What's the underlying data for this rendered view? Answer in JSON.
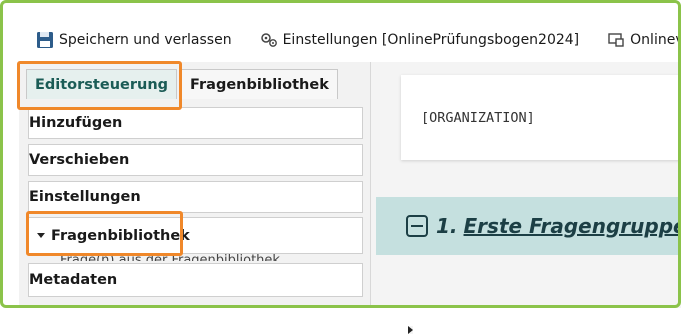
{
  "toolbar": {
    "save_label": "Speichern und verlassen",
    "settings_label": "Einstellungen [OnlinePrüfungsbogen2024]",
    "online_label": "Onlinevo"
  },
  "tabs": [
    "Editorsteuerung",
    "Fragenbibliothek"
  ],
  "accordion": [
    {
      "label": "Hinzufügen",
      "expanded": false
    },
    {
      "label": "Verschieben",
      "expanded": false
    },
    {
      "label": "Einstellungen",
      "expanded": false
    },
    {
      "label": "Fragenbibliothek",
      "expanded": true
    },
    {
      "label": "Metadaten",
      "expanded": false
    }
  ],
  "accordion_clipped_text": "Frage(n) aus der Fragenbibliothek",
  "card_text": "[ORGANIZATION]",
  "group": {
    "number": "1.",
    "title": "Erste Fragengruppe"
  },
  "colors": {
    "frame": "#8bc34a",
    "highlight": "#f0882a",
    "group_bg": "#c5e0df"
  }
}
